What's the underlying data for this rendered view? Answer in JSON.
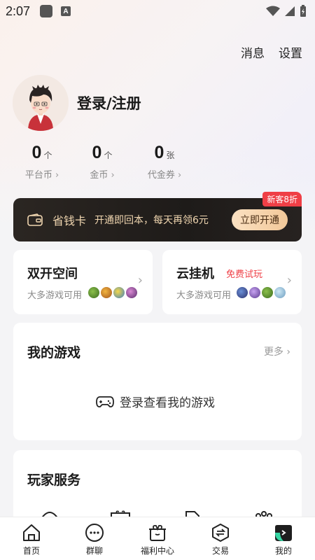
{
  "status_bar": {
    "time": "2:07",
    "a_badge": "A"
  },
  "header": {
    "messages_label": "消息",
    "settings_label": "设置"
  },
  "profile": {
    "login_title": "登录/注册"
  },
  "stats": [
    {
      "value": "0",
      "unit": "个",
      "label": "平台币"
    },
    {
      "value": "0",
      "unit": "个",
      "label": "金币"
    },
    {
      "value": "0",
      "unit": "张",
      "label": "代金券"
    }
  ],
  "vip": {
    "name": "省钱卡",
    "desc": "开通即回本，每天再领6元",
    "button": "立即开通",
    "badge": "新客8折",
    "accent": "#ef3f46"
  },
  "features": [
    {
      "title": "双开空间",
      "tag": "",
      "sub": "大多游戏可用"
    },
    {
      "title": "云挂机",
      "tag": "免费试玩",
      "sub": "大多游戏可用"
    }
  ],
  "my_games": {
    "title": "我的游戏",
    "more": "更多",
    "empty": "登录查看我的游戏"
  },
  "services": {
    "title": "玩家服务"
  },
  "tabs": [
    {
      "label": "首页",
      "icon": "home-icon"
    },
    {
      "label": "群聊",
      "icon": "chat-icon"
    },
    {
      "label": "福利中心",
      "icon": "gift-icon"
    },
    {
      "label": "交易",
      "icon": "exchange-icon"
    },
    {
      "label": "我的",
      "icon": "profile-icon"
    }
  ]
}
